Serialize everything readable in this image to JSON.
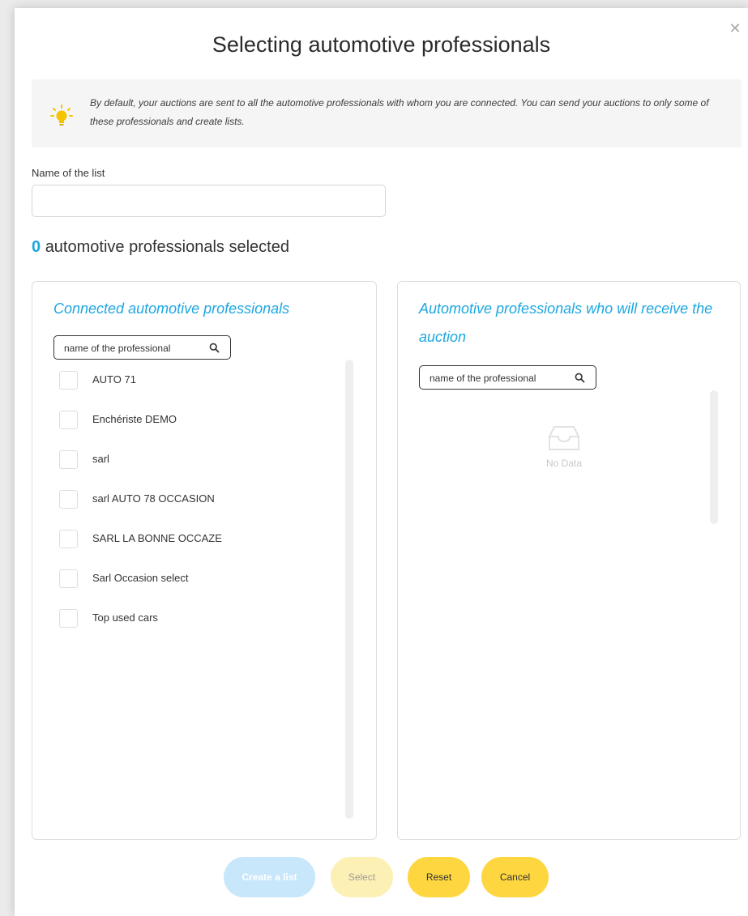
{
  "modal": {
    "title": "Selecting automotive professionals",
    "close_icon": "close-icon"
  },
  "info": {
    "icon": "lightbulb-icon",
    "text": "By default, your auctions are sent to all the automotive professionals with whom you are connected. You can send your auctions to only some of these professionals and create lists."
  },
  "list_name": {
    "label": "Name of the list",
    "value": "",
    "placeholder": ""
  },
  "selection": {
    "count": "0",
    "suffix": "automotive professionals selected"
  },
  "left_panel": {
    "title": "Connected automotive professionals",
    "search": {
      "placeholder": "name of the professional",
      "value": "",
      "icon": "search-icon"
    },
    "items": [
      {
        "label": "AUTO 71",
        "checked": false
      },
      {
        "label": "Enchériste DEMO",
        "checked": false
      },
      {
        "label": "sarl",
        "checked": false
      },
      {
        "label": "sarl AUTO 78 OCCASION",
        "checked": false
      },
      {
        "label": "SARL LA BONNE OCCAZE",
        "checked": false
      },
      {
        "label": "Sarl Occasion select",
        "checked": false
      },
      {
        "label": "Top used cars",
        "checked": false
      }
    ]
  },
  "right_panel": {
    "title": "Automotive professionals who will receive the auction",
    "search": {
      "placeholder": "name of the professional",
      "value": "",
      "icon": "search-icon"
    },
    "empty_icon": "empty-inbox-icon",
    "empty_text": "No Data"
  },
  "buttons": {
    "create_list": "Create a list",
    "select": "Select",
    "reset": "Reset",
    "cancel": "Cancel"
  },
  "colors": {
    "accent": "#1ea7e1",
    "button_yellow": "#fdd640",
    "button_disabled_yellow": "#fdf0b5",
    "button_disabled_blue": "#c8e7fb"
  }
}
